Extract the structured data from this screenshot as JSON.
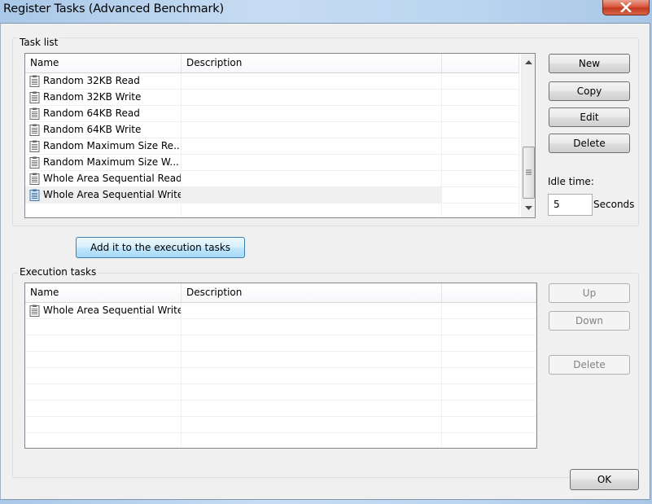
{
  "window": {
    "title": "Register Tasks (Advanced Benchmark)",
    "close_icon": "close-x-icon"
  },
  "task_list": {
    "group_label": "Task list",
    "columns": [
      "Name",
      "Description",
      ""
    ],
    "rows": [
      {
        "name": "Random 32KB Read",
        "description": "",
        "extra": "",
        "selected": false
      },
      {
        "name": "Random 32KB Write",
        "description": "",
        "extra": "",
        "selected": false
      },
      {
        "name": "Random 64KB Read",
        "description": "",
        "extra": "",
        "selected": false
      },
      {
        "name": "Random 64KB Write",
        "description": "",
        "extra": "",
        "selected": false
      },
      {
        "name": "Random Maximum Size Re...",
        "description": "",
        "extra": "",
        "selected": false
      },
      {
        "name": "Random Maximum Size W...",
        "description": "",
        "extra": "",
        "selected": false
      },
      {
        "name": "Whole Area Sequential Read",
        "description": "",
        "extra": "",
        "selected": false
      },
      {
        "name": "Whole Area Sequential Write",
        "description": "",
        "extra": "",
        "selected": true
      }
    ],
    "row_icon": "clipboard-icon",
    "buttons": {
      "new": "New",
      "copy": "Copy",
      "edit": "Edit",
      "delete": "Delete"
    },
    "idle_time_label": "Idle time:",
    "idle_time_value": "5",
    "idle_time_unit": "Seconds"
  },
  "add_button_label": "Add it to the execution tasks",
  "execution_tasks": {
    "group_label": "Execution tasks",
    "columns": [
      "Name",
      "Description",
      ""
    ],
    "rows": [
      {
        "name": "Whole Area Sequential Write",
        "description": "",
        "extra": ""
      }
    ],
    "buttons": {
      "up": "Up",
      "down": "Down",
      "delete": "Delete"
    }
  },
  "ok_label": "OK"
}
